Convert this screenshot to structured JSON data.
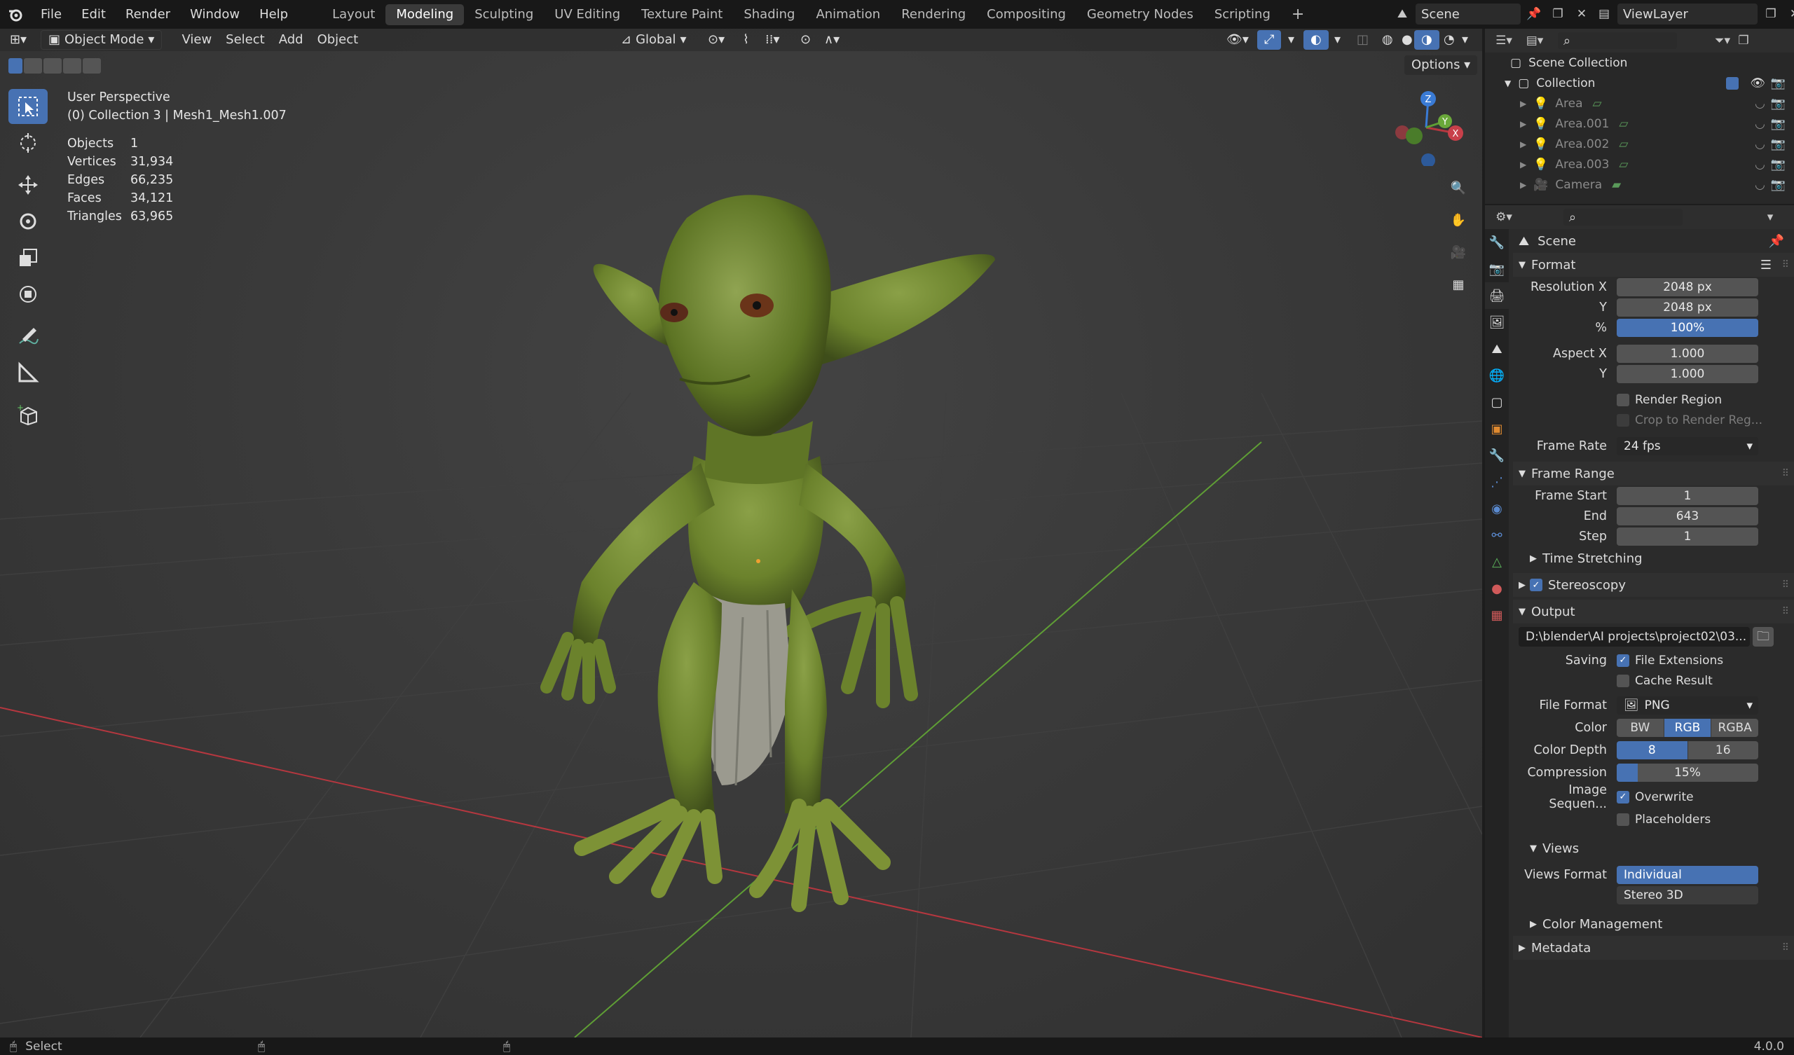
{
  "topbar": {
    "menus": [
      "File",
      "Edit",
      "Render",
      "Window",
      "Help"
    ],
    "workspaces": [
      "Layout",
      "Modeling",
      "Sculpting",
      "UV Editing",
      "Texture Paint",
      "Shading",
      "Animation",
      "Rendering",
      "Compositing",
      "Geometry Nodes",
      "Scripting"
    ],
    "active_workspace": "Modeling",
    "add_workspace": "+",
    "scene": "Scene",
    "view_layer": "ViewLayer"
  },
  "viewport": {
    "mode": "Object Mode",
    "menus": [
      "View",
      "Select",
      "Add",
      "Object"
    ],
    "orientation": "Global",
    "options": "Options",
    "perspective": "User Perspective",
    "collection_info": "(0) Collection 3 | Mesh1_Mesh1.007",
    "stats": [
      {
        "label": "Objects",
        "value": "1"
      },
      {
        "label": "Vertices",
        "value": "31,934"
      },
      {
        "label": "Edges",
        "value": "66,235"
      },
      {
        "label": "Faces",
        "value": "34,121"
      },
      {
        "label": "Triangles",
        "value": "63,965"
      }
    ],
    "gizmo": {
      "x": "X",
      "y": "Y",
      "z": "Z"
    }
  },
  "outliner": {
    "scene_collection": "Scene Collection",
    "collection": "Collection",
    "items": [
      "Area",
      "Area.001",
      "Area.002",
      "Area.003",
      "Camera"
    ]
  },
  "properties": {
    "context": "Scene",
    "format": {
      "title": "Format",
      "resolution_x_label": "Resolution X",
      "resolution_x": "2048 px",
      "y_label": "Y",
      "resolution_y": "2048 px",
      "pct_label": "%",
      "resolution_pct": "100%",
      "aspect_x_label": "Aspect X",
      "aspect_x": "1.000",
      "aspect_y_label": "Y",
      "aspect_y": "1.000",
      "render_region": "Render Region",
      "crop": "Crop to Render Reg...",
      "frame_rate_label": "Frame Rate",
      "frame_rate": "24 fps"
    },
    "frame_range": {
      "title": "Frame Range",
      "start_label": "Frame Start",
      "start": "1",
      "end_label": "End",
      "end": "643",
      "step_label": "Step",
      "step": "1",
      "time_stretching": "Time Stretching"
    },
    "stereoscopy": "Stereoscopy",
    "output": {
      "title": "Output",
      "path": "D:\\blender\\AI projects\\project02\\03...",
      "saving_label": "Saving",
      "file_extensions": "File Extensions",
      "cache_result": "Cache Result",
      "file_format_label": "File Format",
      "file_format": "PNG",
      "color_label": "Color",
      "color_options": [
        "BW",
        "RGB",
        "RGBA"
      ],
      "color_selected": "RGB",
      "color_depth_label": "Color Depth",
      "color_depth_options": [
        "8",
        "16"
      ],
      "color_depth_selected": "8",
      "compression_label": "Compression",
      "compression": "15%",
      "compression_fraction": 0.15,
      "image_seq_label": "Image Sequen...",
      "overwrite": "Overwrite",
      "placeholders": "Placeholders"
    },
    "views": {
      "title": "Views",
      "views_format_label": "Views Format",
      "individual": "Individual",
      "stereo3d": "Stereo 3D"
    },
    "color_management": "Color Management",
    "metadata": "Metadata"
  },
  "statusbar": {
    "left": "Select",
    "version": "4.0.0"
  },
  "colors": {
    "accent": "#4772b3",
    "x_axis": "#b5373f",
    "y_axis": "#5f9e35",
    "z_axis": "#3a7bd5"
  }
}
